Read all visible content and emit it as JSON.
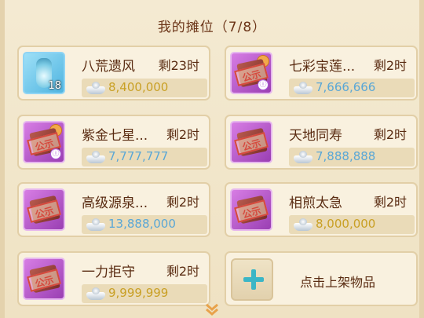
{
  "header": {
    "title": "我的摊位（7/8）"
  },
  "stalls": [
    {
      "name": "八荒遗风",
      "remaining": "剩23时",
      "price": "8,400,000",
      "count": "18"
    },
    {
      "name": "七彩宝莲...",
      "remaining": "剩2时",
      "price": "7,666,666",
      "stamp": "公示"
    },
    {
      "name": "紫金七星...",
      "remaining": "剩2时",
      "price": "7,777,777",
      "stamp": "公示"
    },
    {
      "name": "天地同寿",
      "remaining": "剩2时",
      "price": "7,888,888",
      "stamp": "公示"
    },
    {
      "name": "高级源泉...",
      "remaining": "剩2时",
      "price": "13,888,000",
      "stamp": "公示"
    },
    {
      "name": "相煎太急",
      "remaining": "剩2时",
      "price": "8,000,000",
      "stamp": "公示"
    },
    {
      "name": "一力拒守",
      "remaining": "剩2时",
      "price": "9,999,999",
      "stamp": "公示"
    }
  ],
  "add_slot": {
    "label": "点击上架物品"
  }
}
